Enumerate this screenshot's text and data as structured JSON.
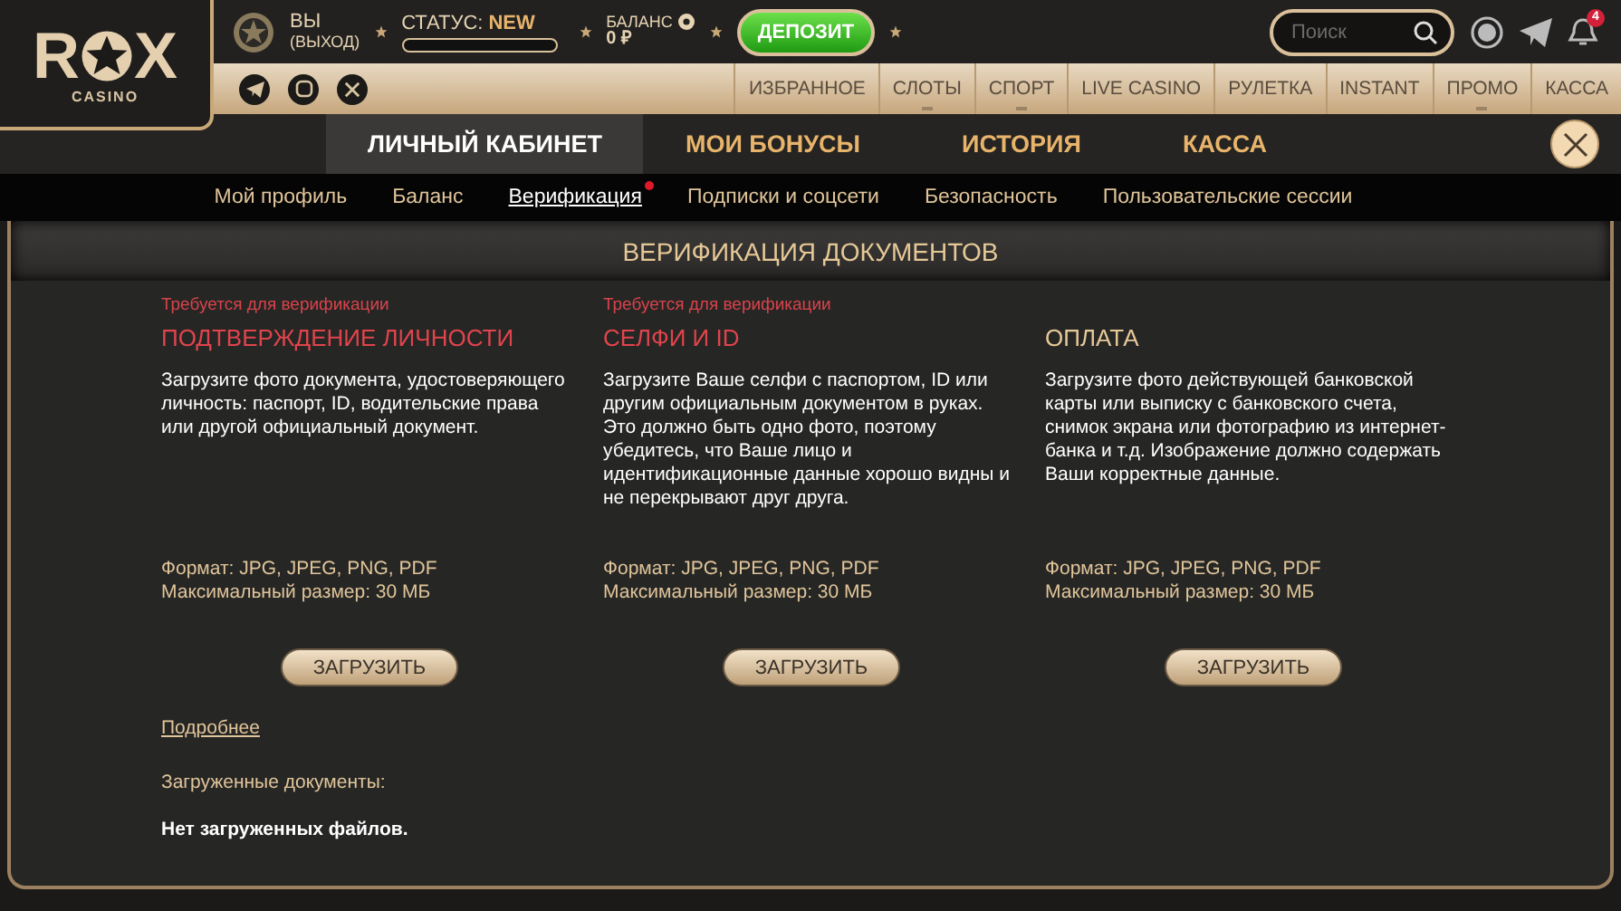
{
  "logo": {
    "left": "R",
    "right": "X",
    "sub": "CASINO"
  },
  "user": {
    "name": "ВЫ",
    "logout": "(ВЫХОД)"
  },
  "status": {
    "label": "СТАТУС:",
    "value": "NEW"
  },
  "balance": {
    "label": "БАЛАНС",
    "amount": "0 ₽"
  },
  "deposit_button": "ДЕПОЗИТ",
  "search": {
    "placeholder": "Поиск"
  },
  "notifications": {
    "count": "4"
  },
  "menu": [
    {
      "label": "ИЗБРАННОЕ",
      "dropdown": false
    },
    {
      "label": "СЛОТЫ",
      "dropdown": true
    },
    {
      "label": "СПОРТ",
      "dropdown": true
    },
    {
      "label": "LIVE CASINO",
      "dropdown": false
    },
    {
      "label": "РУЛЕТКА",
      "dropdown": false
    },
    {
      "label": "INSTANT",
      "dropdown": false
    },
    {
      "label": "ПРОМО",
      "dropdown": true
    },
    {
      "label": "КАССА",
      "dropdown": false
    }
  ],
  "tabs": [
    {
      "label": "ЛИЧНЫЙ КАБИНЕТ",
      "selected": true
    },
    {
      "label": "МОИ БОНУСЫ",
      "selected": false
    },
    {
      "label": "ИСТОРИЯ",
      "selected": false
    },
    {
      "label": "КАССА",
      "selected": false
    }
  ],
  "subnav": [
    {
      "label": "Мой профиль",
      "selected": false,
      "alert": false
    },
    {
      "label": "Баланс",
      "selected": false,
      "alert": false
    },
    {
      "label": "Верификация",
      "selected": true,
      "alert": true
    },
    {
      "label": "Подписки и соцсети",
      "selected": false,
      "alert": false
    },
    {
      "label": "Безопасность",
      "selected": false,
      "alert": false
    },
    {
      "label": "Пользовательские сессии",
      "selected": false,
      "alert": false
    }
  ],
  "heading": "ВЕРИФИКАЦИЯ ДОКУМЕНТОВ",
  "cards": [
    {
      "required": true,
      "note": "Требуется для верификации",
      "title": "ПОДТВЕРЖДЕНИЕ ЛИЧНОСТИ",
      "description": "Загрузите фото документа, удостоверяющего личность: паспорт, ID, водительские права или другой официальный документ.",
      "format": "Формат: JPG, JPEG, PNG, PDF",
      "max_size": "Максимальный размер: 30 МБ",
      "button": "ЗАГРУЗИТЬ"
    },
    {
      "required": true,
      "note": "Требуется для верификации",
      "title": "СЕЛФИ И ID",
      "description": "Загрузите Ваше селфи с паспортом, ID или другим официальным документом в руках. Это должно быть одно фото, поэтому убедитесь, что Ваше лицо и идентификационные данные хорошо видны и не перекрывают друг друга.",
      "format": "Формат: JPG, JPEG, PNG, PDF",
      "max_size": "Максимальный размер: 30 МБ",
      "button": "ЗАГРУЗИТЬ"
    },
    {
      "required": false,
      "title": "ОПЛАТА",
      "description": "Загрузите фото действующей банковской карты или выписку с банковского счета, снимок экрана или фотографию из интернет-банка и т.д. Изображение должно содержать Ваши корректные данные.",
      "format": "Формат: JPG, JPEG, PNG, PDF",
      "max_size": "Максимальный размер: 30 МБ",
      "button": "ЗАГРУЗИТЬ"
    }
  ],
  "more_link": "Подробнее",
  "uploaded_label": "Загруженные документы:",
  "uploaded_empty": "Нет загруженных файлов."
}
